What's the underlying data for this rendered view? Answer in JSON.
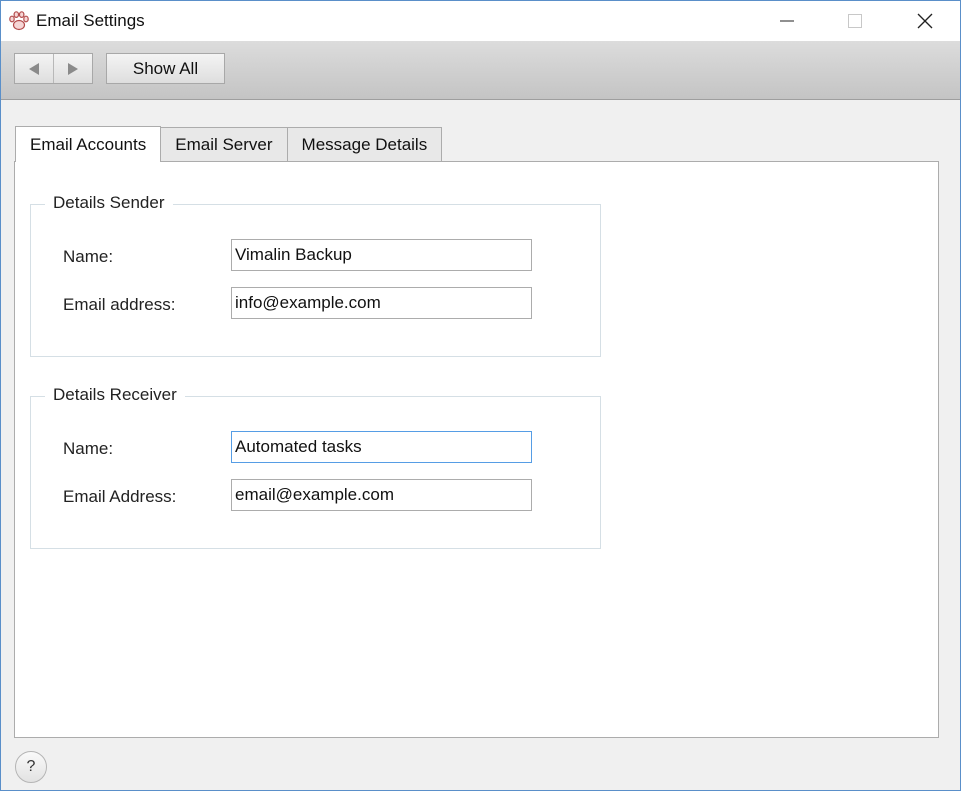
{
  "window": {
    "title": "Email Settings",
    "app_icon": "paw-icon",
    "controls": [
      "minimize-icon",
      "maximize-icon",
      "close-icon"
    ]
  },
  "toolbar": {
    "back_icon": "arrow-left-icon",
    "forward_icon": "arrow-right-icon",
    "show_all_label": "Show All"
  },
  "tabs": [
    {
      "label": "Email Accounts",
      "active": true
    },
    {
      "label": "Email Server",
      "active": false
    },
    {
      "label": "Message Details",
      "active": false
    }
  ],
  "sender": {
    "legend": "Details Sender",
    "name_label": "Name:",
    "name_value": "Vimalin Backup",
    "email_label": "Email address:",
    "email_value": "info@example.com"
  },
  "receiver": {
    "legend": "Details Receiver",
    "name_label": "Name:",
    "name_value": "Automated tasks",
    "email_label": "Email Address:",
    "email_value": "email@example.com"
  },
  "help": {
    "label": "?"
  },
  "colors": {
    "focus_border": "#569de5",
    "window_border": "#5a8fc9"
  }
}
